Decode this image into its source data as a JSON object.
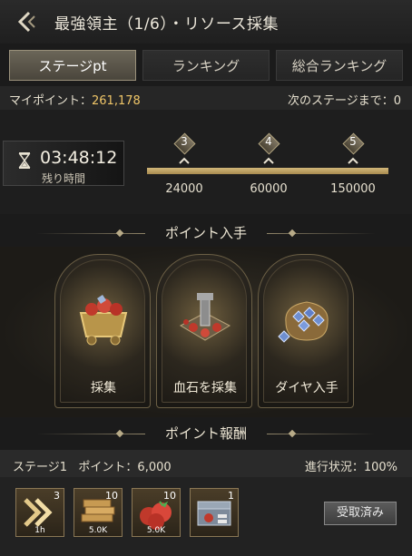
{
  "header": {
    "title": "最強領主（1/6）・リソース採集"
  },
  "tabs": [
    {
      "label": "ステージpt",
      "active": true
    },
    {
      "label": "ランキング",
      "active": false
    },
    {
      "label": "総合ランキング",
      "active": false
    }
  ],
  "points": {
    "label": "マイポイント：",
    "value": "261,178",
    "next_stage_text": "次のステージまで：0"
  },
  "timer": {
    "value": "03:48:12",
    "label": "残り時間"
  },
  "progress": {
    "fill": 1.0,
    "milestones": [
      {
        "stage": "3",
        "score": "24000"
      },
      {
        "stage": "4",
        "score": "60000"
      },
      {
        "stage": "5",
        "score": "150000"
      }
    ]
  },
  "sections": {
    "gain": "ポイント入手",
    "reward": "ポイント報酬"
  },
  "cards": [
    {
      "label": "採集",
      "icon": "ore-cart-icon"
    },
    {
      "label": "血石を採集",
      "icon": "bloodstone-drill-icon"
    },
    {
      "label": "ダイヤ入手",
      "icon": "diamond-sack-icon"
    }
  ],
  "reward": {
    "stage_label": "ステージ1",
    "points_label": "ポイント：6,000",
    "status": "進行状況：100%",
    "items": [
      {
        "icon": "speedup-icon",
        "count": "3",
        "sub": "1h"
      },
      {
        "icon": "wood-icon",
        "count": "10",
        "sub": "5.0K"
      },
      {
        "icon": "tomato-icon",
        "count": "10",
        "sub": "5.0K"
      },
      {
        "icon": "resource-chest-icon",
        "count": "1",
        "sub": ""
      }
    ],
    "claim_button": "受取済み"
  },
  "colors": {
    "accent_gold": "#f0c668",
    "track": "#c9ad6d"
  }
}
